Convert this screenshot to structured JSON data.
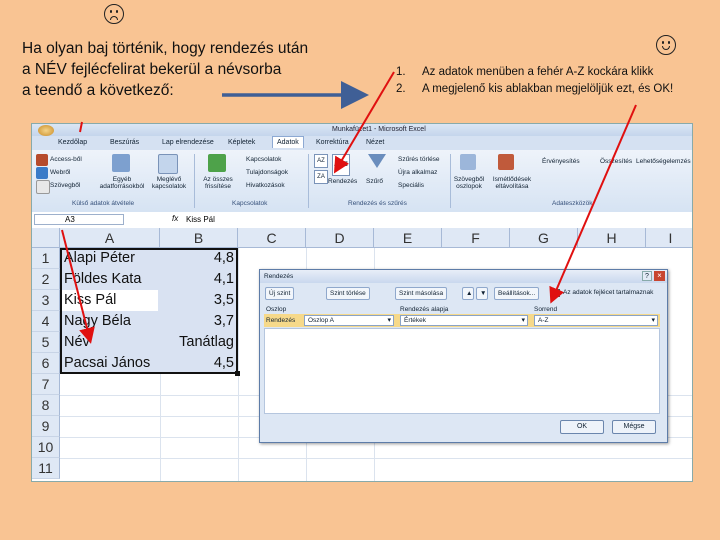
{
  "intro": {
    "lines": [
      "Ha olyan baj történik, hogy rendezés után",
      "a NÉV fejlécfelirat bekerül a névsorba",
      "a teendő a következő:"
    ]
  },
  "icons": {
    "left": "sad-face-icon",
    "right": "smiley-face-icon"
  },
  "steps": [
    {
      "num": "1.",
      "text": "Az adatok menüben a fehér A-Z kockára klikk"
    },
    {
      "num": "2.",
      "text": "A megjelenő kis ablakban megjelöljük ezt, és OK!"
    }
  ],
  "excel": {
    "title": "Munkafüzet1 - Microsoft Excel",
    "tabs": [
      "Kezdőlap",
      "Beszúrás",
      "Lap elrendezése",
      "Képletek",
      "Adatok",
      "Korrektúra",
      "Nézet"
    ],
    "active_tab": "Adatok",
    "ribbon": {
      "ext1": "Access-ből",
      "ext2": "Webről",
      "ext3": "Szövegből",
      "ext4": "Egyéb adatforrásokból",
      "ext5": "Meglévő kapcsolatok",
      "grp1": "Külső adatok átvétele",
      "conn1": "Az összes frissítése",
      "conn2": "Kapcsolatok",
      "conn3": "Tulajdonságok",
      "conn4": "Hivatkozások",
      "grp2": "Kapcsolatok",
      "sort_az": "A→Z",
      "sort": "Rendezés",
      "filter": "Szűrő",
      "clear": "Szűrés törlése",
      "reapply": "Újra alkalmaz",
      "advanced": "Speciális",
      "grp3": "Rendezés és szűrés",
      "tools1": "Szövegből oszlopok",
      "tools2": "Ismétlődések eltávolítása",
      "tools3": "Érvényesítés",
      "tools4": "Összesítés",
      "tools5": "Lehetőségelemzés",
      "grp4": "Adateszközök"
    },
    "namebox": "A3",
    "formula": "Kiss Pál",
    "fx": "fx",
    "columns": [
      "A",
      "B",
      "C",
      "D",
      "E",
      "F",
      "G",
      "H",
      "I"
    ],
    "rows": [
      "1",
      "2",
      "3",
      "4",
      "5",
      "6",
      "7",
      "8",
      "9",
      "10",
      "11"
    ],
    "data": [
      {
        "name": "Alapi Péter",
        "score": "4,8"
      },
      {
        "name": "Földes Kata",
        "score": "4,1"
      },
      {
        "name": "Kiss Pál",
        "score": "3,5"
      },
      {
        "name": "Nagy Béla",
        "score": "3,7"
      },
      {
        "name": "Név",
        "score": "Tanátlag"
      },
      {
        "name": "Pacsai János",
        "score": "4,5"
      }
    ],
    "dialog": {
      "title": "Rendezés",
      "btn_add": "Új szint",
      "btn_delete": "Szint törlése",
      "btn_copy": "Szint másolása",
      "btn_options": "Beállítások...",
      "checkbox_label": "Az adatok fejlécet tartalmaznak",
      "col_header_label": "Oszlop",
      "sorton_header_label": "Rendezés alapja",
      "order_header_label": "Sorrend",
      "row_label": "Rendezés",
      "column_value": "Oszlop A",
      "sorton_value": "Értékek",
      "order_value": "A-Z",
      "ok": "OK",
      "cancel": "Mégse"
    }
  }
}
